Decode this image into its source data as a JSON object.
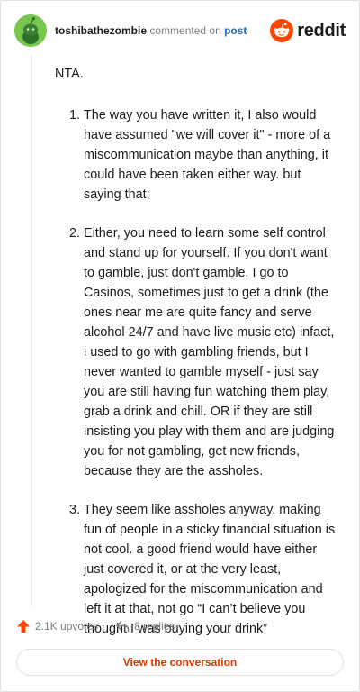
{
  "header": {
    "username": "toshibathezombie",
    "action_text": "commented on",
    "post_link": "post",
    "brand": "reddit"
  },
  "comment": {
    "intro": "NTA.",
    "points": [
      "The way you have written it, I also would have assumed \"we will cover it\" - more of a miscommunication maybe than anything, it could have been taken either way. but saying that;",
      "Either, you need to learn some self control and stand up for yourself. If you don't want to gamble, just don't gamble. I go to Casinos, sometimes just to get a drink (the ones near me are quite fancy and serve alcohol 24/7 and have live music etc) infact, i used to go with gambling friends, but I never wanted to gamble myself - just say you are still having fun watching them play, grab a drink and chill. OR if they are still insisting you play with them and are judging you for not gambling, get new friends, because they are the assholes.",
      "They seem like assholes anyway. making fun of people in a sticky financial situation is not cool. a good friend would have either just covered it, or at the very least, apologized for the miscommunication and left it at that, not go “I can’t believe you thought I was buying your drink”"
    ]
  },
  "actions": {
    "upvotes": "2.1K upvotes",
    "replies": "8 replies"
  },
  "view_button": "View the conversation",
  "colors": {
    "upvote": "#ff4500",
    "brand": "#ff4500",
    "link": "#2b6cb0",
    "button_text": "#d93a00",
    "avatar_bg": "#78c850"
  },
  "icons": {
    "avatar": "snoo-avatar-icon",
    "logo": "reddit-logo-icon",
    "upvote": "upvote-arrow-icon",
    "reply": "reply-arrow-icon"
  }
}
